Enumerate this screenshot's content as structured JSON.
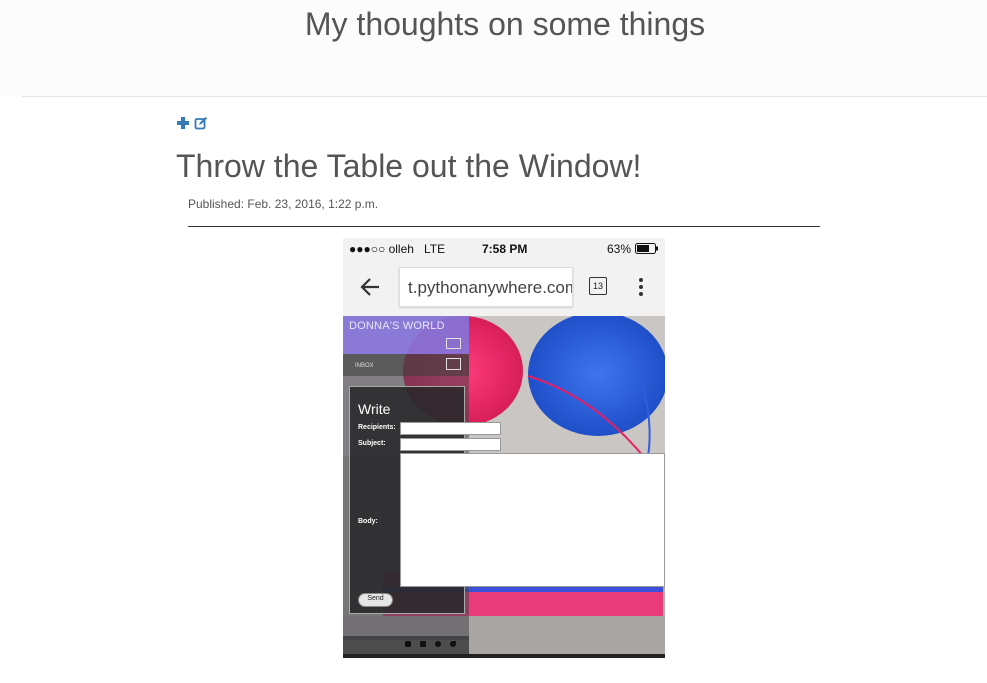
{
  "site": {
    "title": "My thoughts on some things"
  },
  "toolbar": {
    "add_icon": "plus-icon",
    "edit_icon": "edit-icon"
  },
  "post": {
    "title": "Throw the Table out the Window!",
    "published": "Published: Feb. 23, 2016, 1:22 p.m."
  },
  "phone": {
    "status": {
      "carrier": "●●●○○ olleh",
      "network": "LTE",
      "time": "7:58 PM",
      "battery": "63%"
    },
    "browser": {
      "url": "t.pythonanywhere.com",
      "tab_count": "13",
      "back_icon": "back-arrow-icon",
      "menu_icon": "kebab-menu-icon"
    },
    "app": {
      "brand": "DONNA'S WORLD",
      "inbox_label": "INBOX",
      "write_title": "Write",
      "recipients_label": "Recipients:",
      "subject_label": "Subject:",
      "body_label": "Body:",
      "send_label": "Send"
    }
  },
  "colors": {
    "accent_icon": "#337ab7",
    "brand_bar": "#8c78e6"
  }
}
